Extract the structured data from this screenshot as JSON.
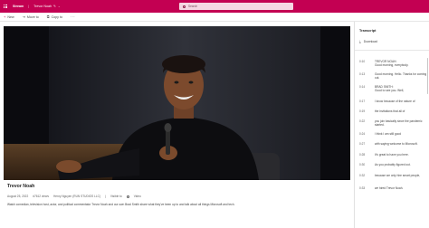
{
  "header": {
    "app_name": "Stream",
    "doc_title": "Trevor Noah",
    "search_placeholder": "Search"
  },
  "toolbar": {
    "new_label": "New",
    "move_label": "Move to",
    "copy_label": "Copy to",
    "more_label": "···"
  },
  "video": {
    "title": "Trevor Noah",
    "date": "August 25, 2022",
    "views": "#7612 views",
    "author": "Henry Nguyen (RUN STUDIOS LLC)",
    "visibility": "Visible to",
    "type": "Video",
    "description": "Watch comedian, television host, actor, and political commentator Trevor Noah and our own Brad Smith share what they've been up to and talk about all things Microsoft and tech."
  },
  "transcript": {
    "title": "Transcript",
    "download_label": "Download",
    "entries": [
      {
        "time": "0:10",
        "speaker": "TREVOR NOAH:",
        "text": "Good morning, everybody."
      },
      {
        "time": "0:13",
        "text": "Good morning. Hello. Thanks for coming out."
      },
      {
        "time": "0:14",
        "speaker": "BRAD SMITH:",
        "text": "Good to see you. Well,"
      },
      {
        "time": "0:17",
        "text": "I know because of the nature of"
      },
      {
        "time": "0:19",
        "text": "the invitations that all of"
      },
      {
        "time": "0:22",
        "text": "you join basically since the pandemic started."
      },
      {
        "time": "0:24",
        "text": "I think I am still good"
      },
      {
        "time": "0:27",
        "text": "with saying welcome to Microsoft."
      },
      {
        "time": "0:28",
        "text": "It's great to have you here."
      },
      {
        "time": "0:30",
        "text": "As you probably figured out."
      },
      {
        "time": "0:32",
        "text": "because we only hire smart people,"
      },
      {
        "time": "0:33",
        "text": "we hired Trevor Noah."
      }
    ]
  }
}
